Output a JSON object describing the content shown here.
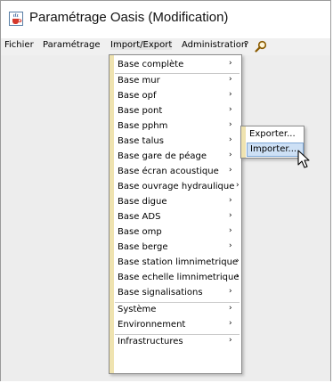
{
  "window": {
    "title": "Paramétrage Oasis (Modification)"
  },
  "menubar": {
    "items": [
      "Fichier",
      "Paramétrage",
      "Import/Export",
      "Administration",
      "?"
    ]
  },
  "icons": {
    "app": "java-coffee-cup-icon",
    "search": "magnifier-icon",
    "submenu": "triangle-right-icon",
    "cursor": "arrow-pointer-icon"
  },
  "menu_import_export": {
    "items": [
      "Base complète",
      "Base mur",
      "Base opf",
      "Base pont",
      "Base pphm",
      "Base talus",
      "Base gare de péage",
      "Base écran acoustique",
      "Base ouvrage hydraulique",
      "Base digue",
      "Base ADS",
      "Base omp",
      "Base berge",
      "Base station limnimetrique",
      "Base echelle limnimetrique",
      "Base signalisations",
      "Système",
      "Environnement",
      "Infrastructures"
    ],
    "arrow": "›"
  },
  "submenu_base_pphm": {
    "items": [
      "Exporter...",
      "Importer..."
    ],
    "highlighted": "Importer..."
  },
  "colors": {
    "menu_stripe": "#efe3b0",
    "highlight": "#cde0f5",
    "highlight_border": "#7fa8d6"
  }
}
